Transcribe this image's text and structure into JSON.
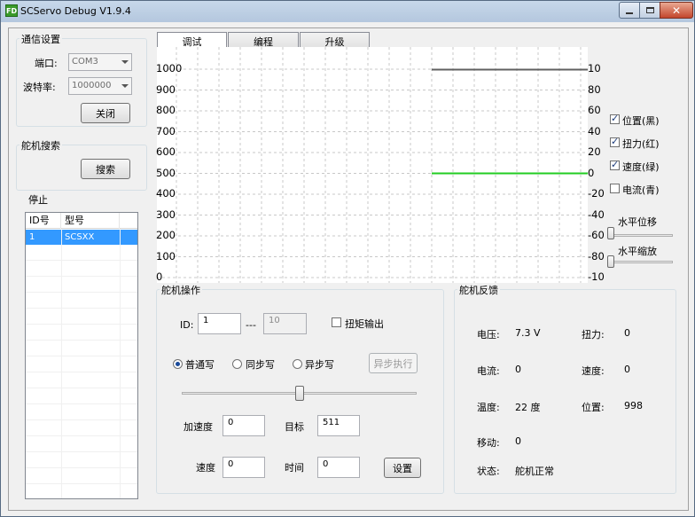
{
  "window": {
    "title": "SCServo Debug V1.9.4",
    "app_icon": "FD"
  },
  "comm": {
    "title": "通信设置",
    "port_label": "端口:",
    "port_value": "COM3",
    "baud_label": "波特率:",
    "baud_value": "1000000",
    "close_button": "关闭"
  },
  "search": {
    "title": "舵机搜索",
    "search_button": "搜索",
    "status": "停止",
    "columns": [
      "ID号",
      "型号"
    ],
    "rows": [
      {
        "id": "1",
        "model": "SCSXX"
      }
    ]
  },
  "tabs": [
    "调试",
    "编程",
    "升级"
  ],
  "chart": {
    "left_ticks": [
      "0",
      "100",
      "200",
      "300",
      "400",
      "500",
      "600",
      "700",
      "800",
      "900",
      "1000"
    ],
    "right_ticks": [
      "-10",
      "-80",
      "-60",
      "-40",
      "-20",
      "0",
      "20",
      "40",
      "60",
      "80",
      "10"
    ],
    "legend": [
      {
        "label": "位置(黑)",
        "checked": true,
        "color": "#606060"
      },
      {
        "label": "扭力(红)",
        "checked": true,
        "color": "#ff0000"
      },
      {
        "label": "速度(绿)",
        "checked": true,
        "color": "#22cc22"
      },
      {
        "label": "电流(青)",
        "checked": false,
        "color": "#00cccc"
      }
    ],
    "h_offset_label": "水平位移",
    "h_zoom_label": "水平缩放"
  },
  "chart_data": {
    "type": "line",
    "ylim": [
      0,
      1000
    ],
    "y2lim": [
      -100,
      100
    ],
    "series": [
      {
        "name": "位置(黑)",
        "color": "#606060",
        "y": 998
      },
      {
        "name": "速度(绿)",
        "color": "#22cc22",
        "y": 500
      }
    ]
  },
  "op": {
    "title": "舵机操作",
    "id_label": "ID:",
    "id_value": "1",
    "range_sep": "---",
    "id_end_value": "10",
    "torque_label": "扭矩输出",
    "torque_checked": false,
    "mode_normal": "普通写",
    "mode_sync": "同步写",
    "mode_async": "异步写",
    "exec_button": "异步执行",
    "slider_fraction": 0.5,
    "accel_label": "加速度",
    "accel_value": "0",
    "target_label": "目标",
    "target_value": "511",
    "speed_label": "速度",
    "speed_value": "0",
    "time_label": "时间",
    "time_value": "0",
    "set_button": "设置"
  },
  "fb": {
    "title": "舵机反馈",
    "voltage_label": "电压:",
    "voltage_value": "7.3 V",
    "torque_label": "扭力:",
    "torque_value": "0",
    "current_label": "电流:",
    "current_value": "0",
    "speed_label": "速度:",
    "speed_value": "0",
    "temp_label": "温度:",
    "temp_value": "22 度",
    "position_label": "位置:",
    "position_value": "998",
    "move_label": "移动:",
    "move_value": "0",
    "status_label": "状态:",
    "status_value": "舵机正常"
  }
}
